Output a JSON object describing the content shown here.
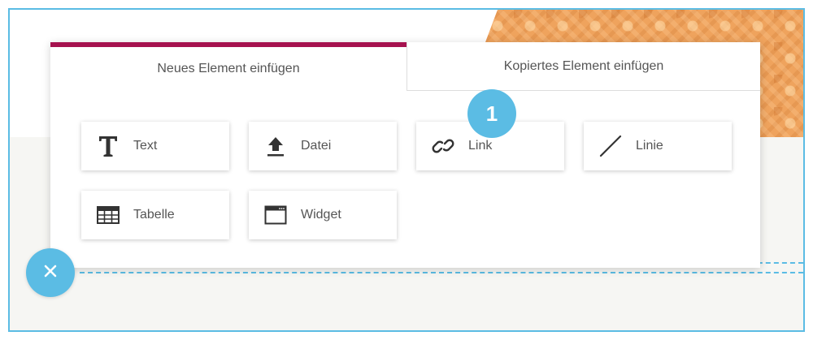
{
  "tabs": [
    {
      "label": "Neues Element einfügen",
      "active": true
    },
    {
      "label": "Kopiertes Element einfügen",
      "active": false
    }
  ],
  "elements": [
    {
      "label": "Text",
      "icon": "text-icon"
    },
    {
      "label": "Datei",
      "icon": "upload-icon"
    },
    {
      "label": "Link",
      "icon": "link-icon"
    },
    {
      "label": "Linie",
      "icon": "line-icon"
    },
    {
      "label": "Tabelle",
      "icon": "table-icon"
    },
    {
      "label": "Widget",
      "icon": "widget-icon"
    }
  ],
  "step_badge": "1",
  "close_icon": "close-icon",
  "colors": {
    "accent": "#5bbce4",
    "active_tab": "#a6124f",
    "text": "#555555",
    "icon": "#333333"
  }
}
